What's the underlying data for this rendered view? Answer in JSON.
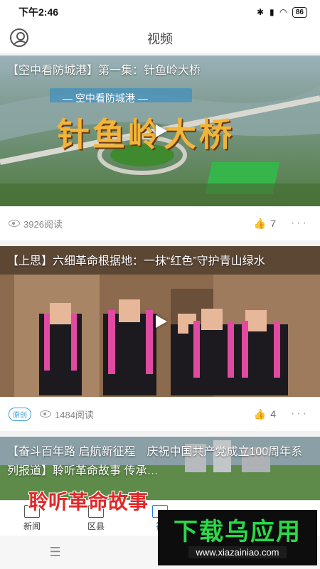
{
  "status": {
    "time": "下午2:46",
    "battery": "86"
  },
  "header": {
    "title": "视频"
  },
  "feed": [
    {
      "title": "【空中看防城港】第一集：针鱼岭大桥",
      "overlay_top": "— 空中看防城港 —",
      "overlay_big": "针鱼岭大桥",
      "views": "3926阅读",
      "likes": "7",
      "badge": ""
    },
    {
      "title": "【上思】六细革命根据地：一抹“红色”守护青山绿水",
      "views": "1484阅读",
      "likes": "4",
      "badge": "原创"
    },
    {
      "title": "【奋斗百年路 启航新征程　庆祝中国共产党成立100周年系列报道】聆听革命故事 传承…",
      "overlay_big": "聆听革命故事"
    }
  ],
  "tabs": [
    {
      "label": "新闻",
      "icon": "news-icon"
    },
    {
      "label": "区县",
      "icon": "building-icon"
    },
    {
      "label": "视",
      "icon": "video-icon"
    },
    {
      "label": "",
      "icon": "people-icon"
    },
    {
      "label": "",
      "icon": "news-icon"
    }
  ],
  "watermark": {
    "title": "下载乌应用",
    "url": "www.xiazainiao.com"
  },
  "colors": {
    "accent": "#2a7ed6",
    "badge": "#3aa0d8",
    "watermark_green": "#2bd84a"
  }
}
